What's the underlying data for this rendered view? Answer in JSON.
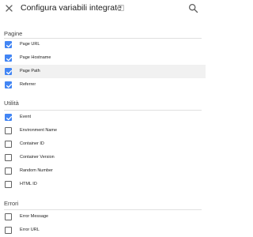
{
  "header": {
    "title": "Configura variabili integrate",
    "help_glyph": "?",
    "close_icon": "close-icon",
    "search_icon": "search-icon"
  },
  "sections": [
    {
      "title": "Pagine",
      "items": [
        {
          "label": "Page URL",
          "checked": true,
          "highlighted": false
        },
        {
          "label": "Page Hostname",
          "checked": true,
          "highlighted": false
        },
        {
          "label": "Page Path",
          "checked": true,
          "highlighted": true
        },
        {
          "label": "Referrer",
          "checked": true,
          "highlighted": false
        }
      ]
    },
    {
      "title": "Utilità",
      "items": [
        {
          "label": "Event",
          "checked": true,
          "highlighted": false
        },
        {
          "label": "Environment Name",
          "checked": false,
          "highlighted": false
        },
        {
          "label": "Container ID",
          "checked": false,
          "highlighted": false
        },
        {
          "label": "Container Version",
          "checked": false,
          "highlighted": false
        },
        {
          "label": "Random Number",
          "checked": false,
          "highlighted": false
        },
        {
          "label": "HTML ID",
          "checked": false,
          "highlighted": false
        }
      ]
    },
    {
      "title": "Errori",
      "items": [
        {
          "label": "Error Message",
          "checked": false,
          "highlighted": false
        },
        {
          "label": "Error URL",
          "checked": false,
          "highlighted": false
        }
      ]
    }
  ],
  "colors": {
    "checkbox_checked": "#4285f4",
    "checkbox_border": "#616161",
    "row_highlight": "#f1f1f1"
  }
}
